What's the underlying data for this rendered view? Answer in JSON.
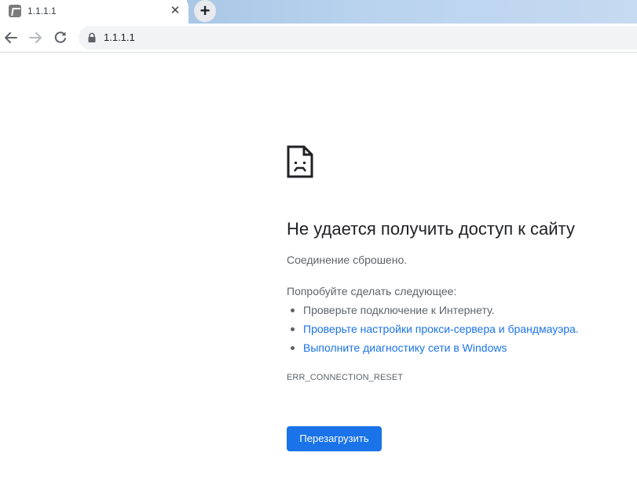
{
  "tab": {
    "title": "1.1.1.1",
    "close": "✕"
  },
  "new_tab": "+",
  "toolbar": {
    "url": "1.1.1.1"
  },
  "error": {
    "heading": "Не удается получить доступ к сайту",
    "subtitle": "Соединение сброшено.",
    "suggest_heading": "Попробуйте сделать следующее:",
    "suggestions": [
      {
        "text": "Проверьте подключение к Интернету.",
        "link": false
      },
      {
        "text": "Проверьте настройки прокси-сервера и брандмауэра.",
        "link": true
      },
      {
        "text": "Выполните диагностику сети в Windows",
        "link": true
      }
    ],
    "code": "ERR_CONNECTION_RESET",
    "reload_label": "Перезагрузить"
  },
  "colors": {
    "accent": "#1a73e8",
    "text_secondary": "#5f6368",
    "tabstrip": "#b9d3ee"
  },
  "icons": [
    "favicon-icon",
    "close-icon",
    "plus-icon",
    "back-arrow-icon",
    "forward-arrow-icon",
    "reload-icon",
    "lock-icon",
    "sad-page-icon"
  ]
}
